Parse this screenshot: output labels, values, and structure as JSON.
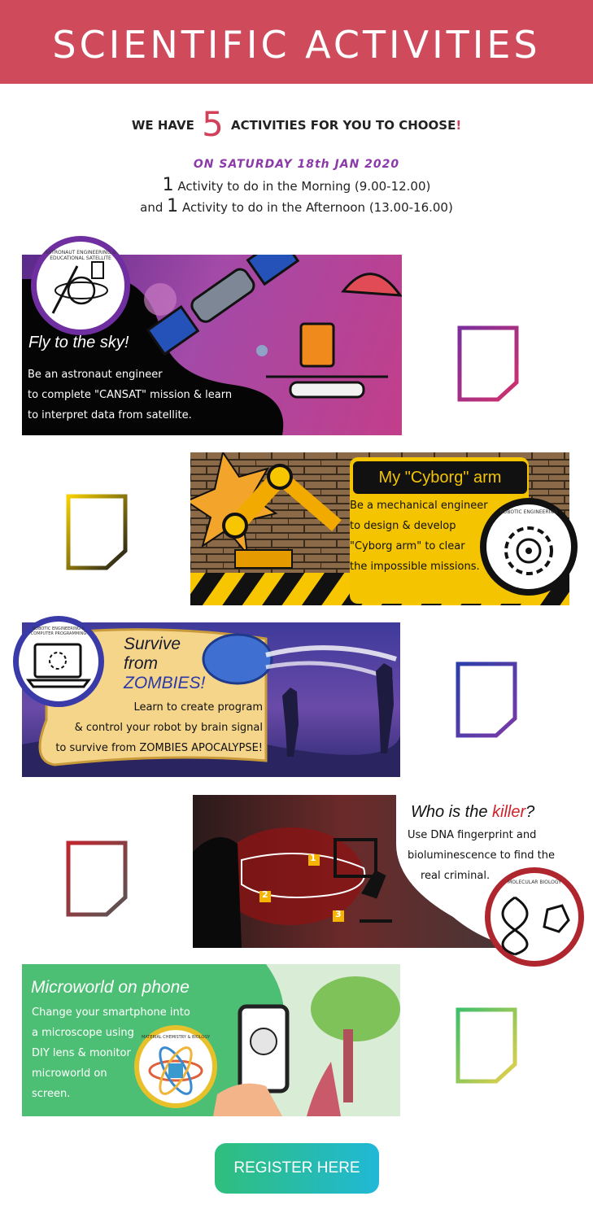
{
  "header": {
    "title": "SCIENTIFIC ACTIVITIES"
  },
  "intro": {
    "pre": "WE HAVE",
    "count": "5",
    "post": "ACTIVITIES FOR YOU TO CHOOSE",
    "bang": "!",
    "date": "ON SATURDAY 18th JAN 2020",
    "morning_num": "1",
    "morning_text": "Activity to do in the Morning (9.00-12.00)",
    "afternoon_pre": "and",
    "afternoon_num": "1",
    "afternoon_text": "Activity to do in the Afternoon (13.00-16.00)"
  },
  "activities": [
    {
      "title": "Fly to the sky!",
      "badge": "ASTRONAUT ENGINEERING & EDUCATIONAL SATELLITE",
      "lines": [
        "Be an astronaut engineer",
        "to complete \"CANSAT\" mission & learn",
        "to interpret data from satellite."
      ]
    },
    {
      "title": "My \"Cyborg\" arm",
      "badge": "ROBOTIC ENGINEERING",
      "lines": [
        "Be a mechanical engineer",
        "to design & develop",
        "\"Cyborg arm\" to clear",
        "the impossible missions."
      ]
    },
    {
      "title_1": "Survive",
      "title_2": "from",
      "title_3": "ZOMBIES!",
      "badge": "ROBOTIC ENGINEERING & COMPUTER PROGRAMMING",
      "lines": [
        "Learn to create program",
        "& control your robot by brain signal",
        "to survive from ZOMBIES APOCALYPSE!"
      ]
    },
    {
      "title_pre": "Who is the",
      "title_word": "killer",
      "title_q": "?",
      "badge": "MOLECULAR BIOLOGY",
      "lines": [
        "Use DNA fingerprint and",
        "bioluminescence to find the",
        "real criminal."
      ],
      "markers": [
        "1",
        "2",
        "3"
      ]
    },
    {
      "title": "Microworld on phone",
      "badge": "MATERIAL CHEMISTRY & BIOLOGY",
      "lines": [
        "Change your smartphone into",
        "a microscope using",
        "DIY lens & monitor",
        "microworld on",
        "screen."
      ]
    }
  ],
  "register": {
    "label": "REGISTER HERE"
  },
  "colors": {
    "header": "#cf4b5c",
    "accent": "#d2405a",
    "date": "#8b3aa8",
    "cta_from": "#2fbf7c",
    "cta_to": "#20b8d6"
  }
}
